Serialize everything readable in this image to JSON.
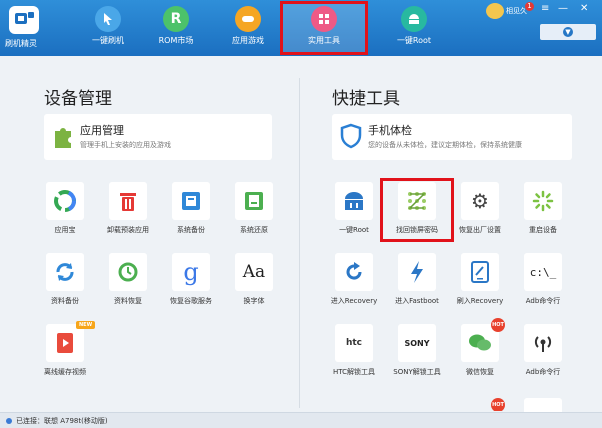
{
  "app": {
    "logo_label": "刷机精灵"
  },
  "nav": [
    {
      "label": "一键刷机"
    },
    {
      "label": "ROM市场"
    },
    {
      "label": "应用游戏"
    },
    {
      "label": "实用工具"
    },
    {
      "label": "一键Root"
    }
  ],
  "titlebar": {
    "user": "相见久",
    "badge": "1",
    "controls": [
      "≡",
      "—",
      "✕"
    ]
  },
  "left": {
    "title": "设备管理",
    "feature": {
      "title": "应用管理",
      "subtitle": "管理手机上安装的应用及游戏"
    },
    "tools": [
      "应用宝",
      "卸载预装应用",
      "系统备份",
      "系统还原",
      "资料备份",
      "资料恢复",
      "恢复谷歌服务",
      "换字体",
      "离线缓存视频"
    ],
    "new_badge": "NEW"
  },
  "right": {
    "title": "快捷工具",
    "feature": {
      "title": "手机体检",
      "subtitle": "您的设备从未体检，建议定期体检，保持系统健康"
    },
    "tools": [
      "一键Root",
      "找回锁屏密码",
      "恢复出厂设置",
      "重启设备",
      "进入Recovery",
      "进入Fastboot",
      "刷入Recovery",
      "Adb命令行",
      "HTC解锁工具",
      "SONY解锁工具",
      "微信恢复",
      "Adb命令行"
    ],
    "hot_badge": "HOT"
  },
  "status": {
    "text": "已连接：联想 A798t(移动版)"
  },
  "colors": {
    "brand": "#1b6fc0",
    "highlight": "#e1121a"
  }
}
